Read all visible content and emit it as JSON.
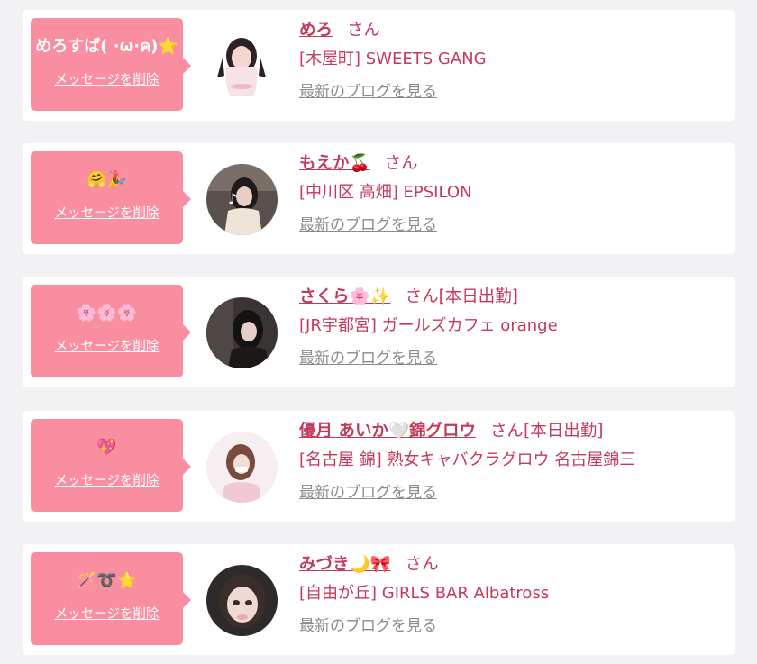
{
  "accent_color": "#f98ea1",
  "link_color": "#c43a5b",
  "cards": [
    {
      "message": "めろすば( ·ω·ค)⭐",
      "delete_label": "メッセージを削除",
      "avatar": "girl-photo-pink-outfit",
      "name": "めろ",
      "suffix": "さん",
      "shop": "[木屋町] SWEETS GANG",
      "blog_label": "最新のブログを見る"
    },
    {
      "message": "🤗🎉",
      "delete_label": "メッセージを削除",
      "avatar": "girl-photo-tiktok",
      "name": "もえか🍒",
      "suffix": "さん",
      "shop": "[中川区 高畑] EPSILON",
      "blog_label": "最新のブログを見る"
    },
    {
      "message": "🌸🌸🌸",
      "delete_label": "メッセージを削除",
      "avatar": "girl-photo-dark",
      "name": "さくら🌸✨",
      "suffix": "さん[本日出勤]",
      "shop": "[JR宇都宮] ガールズカフェ orange",
      "blog_label": "最新のブログを見る"
    },
    {
      "message": "💖",
      "delete_label": "メッセージを削除",
      "avatar": "girl-photo-light",
      "name": "優月 あいか🤍錦グロウ",
      "suffix": "さん[本日出勤]",
      "shop": "[名古屋 錦] 熟女キャバクラグロウ 名古屋錦三",
      "blog_label": "最新のブログを見る"
    },
    {
      "message": "🪄➰⭐",
      "delete_label": "メッセージを削除",
      "avatar": "girl-photo-closeup",
      "name": "みづき🌙🎀",
      "suffix": "さん",
      "shop": "[自由が丘] GIRLS BAR Albatross",
      "blog_label": "最新のブログを見る"
    }
  ]
}
